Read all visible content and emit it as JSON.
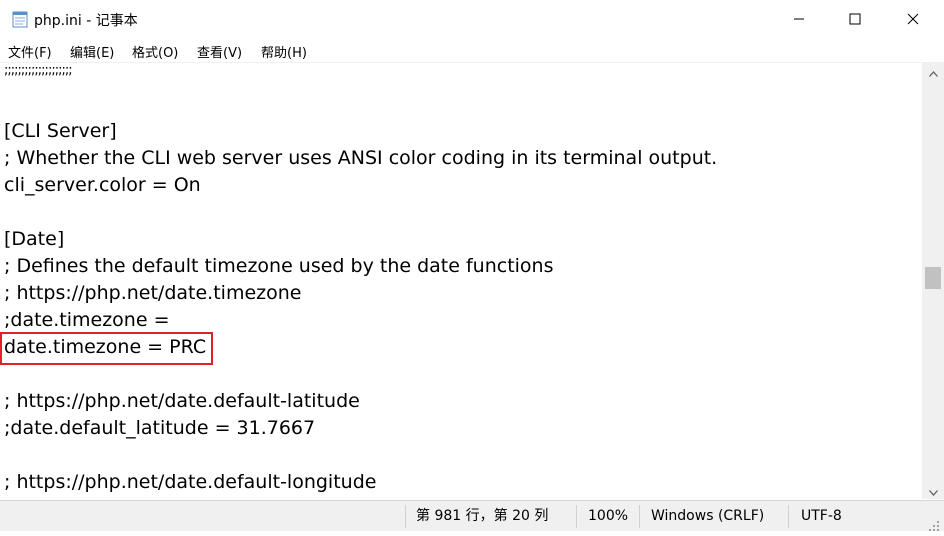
{
  "window": {
    "title": "php.ini - 记事本",
    "minimize_icon": "minimize-icon",
    "maximize_icon": "maximize-icon",
    "close_icon": "close-icon"
  },
  "menu": {
    "items": [
      "文件(F)",
      "编辑(E)",
      "格式(O)",
      "查看(V)",
      "帮助(H)"
    ]
  },
  "editor": {
    "lines": [
      ";;;;;;;;;;;;;;;;;;;;",
      "",
      "[CLI Server]",
      "; Whether the CLI web server uses ANSI color coding in its terminal output.",
      "cli_server.color = On",
      "",
      "[Date]",
      "; Defines the default timezone used by the date functions",
      "; https://php.net/date.timezone",
      ";date.timezone =",
      "date.timezone = PRC",
      "",
      "; https://php.net/date.default-latitude",
      ";date.default_latitude = 31.7667",
      "",
      "; https://php.net/date.default-longitude"
    ],
    "highlight_color": "#e0202a"
  },
  "status": {
    "position": "第 981 行，第 20 列",
    "zoom": "100%",
    "line_ending": "Windows (CRLF)",
    "encoding": "UTF-8"
  }
}
